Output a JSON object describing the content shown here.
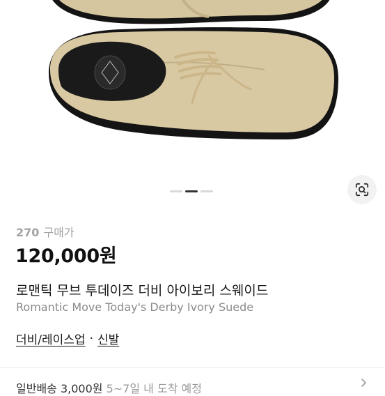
{
  "product": {
    "image_alt": "beige suede derby shoes",
    "carousel": {
      "total": 3,
      "active": 2
    },
    "stats": {
      "count": "270",
      "label": "구매가"
    },
    "price": "120,000원",
    "name_ko": "로맨틱 무브 투데이즈 더비 아이보리 스웨이드",
    "name_en": "Romantic Move Today's Derby Ivory Suede",
    "categories": [
      "더비/레이스업",
      "신발"
    ],
    "category_separator": "·"
  },
  "shipping": {
    "label": "일반배송 3,000원",
    "eta": "5~7일 내 도착 예정"
  },
  "icons": {
    "lens": "image-search-icon",
    "chevron": "chevron-right-icon"
  }
}
